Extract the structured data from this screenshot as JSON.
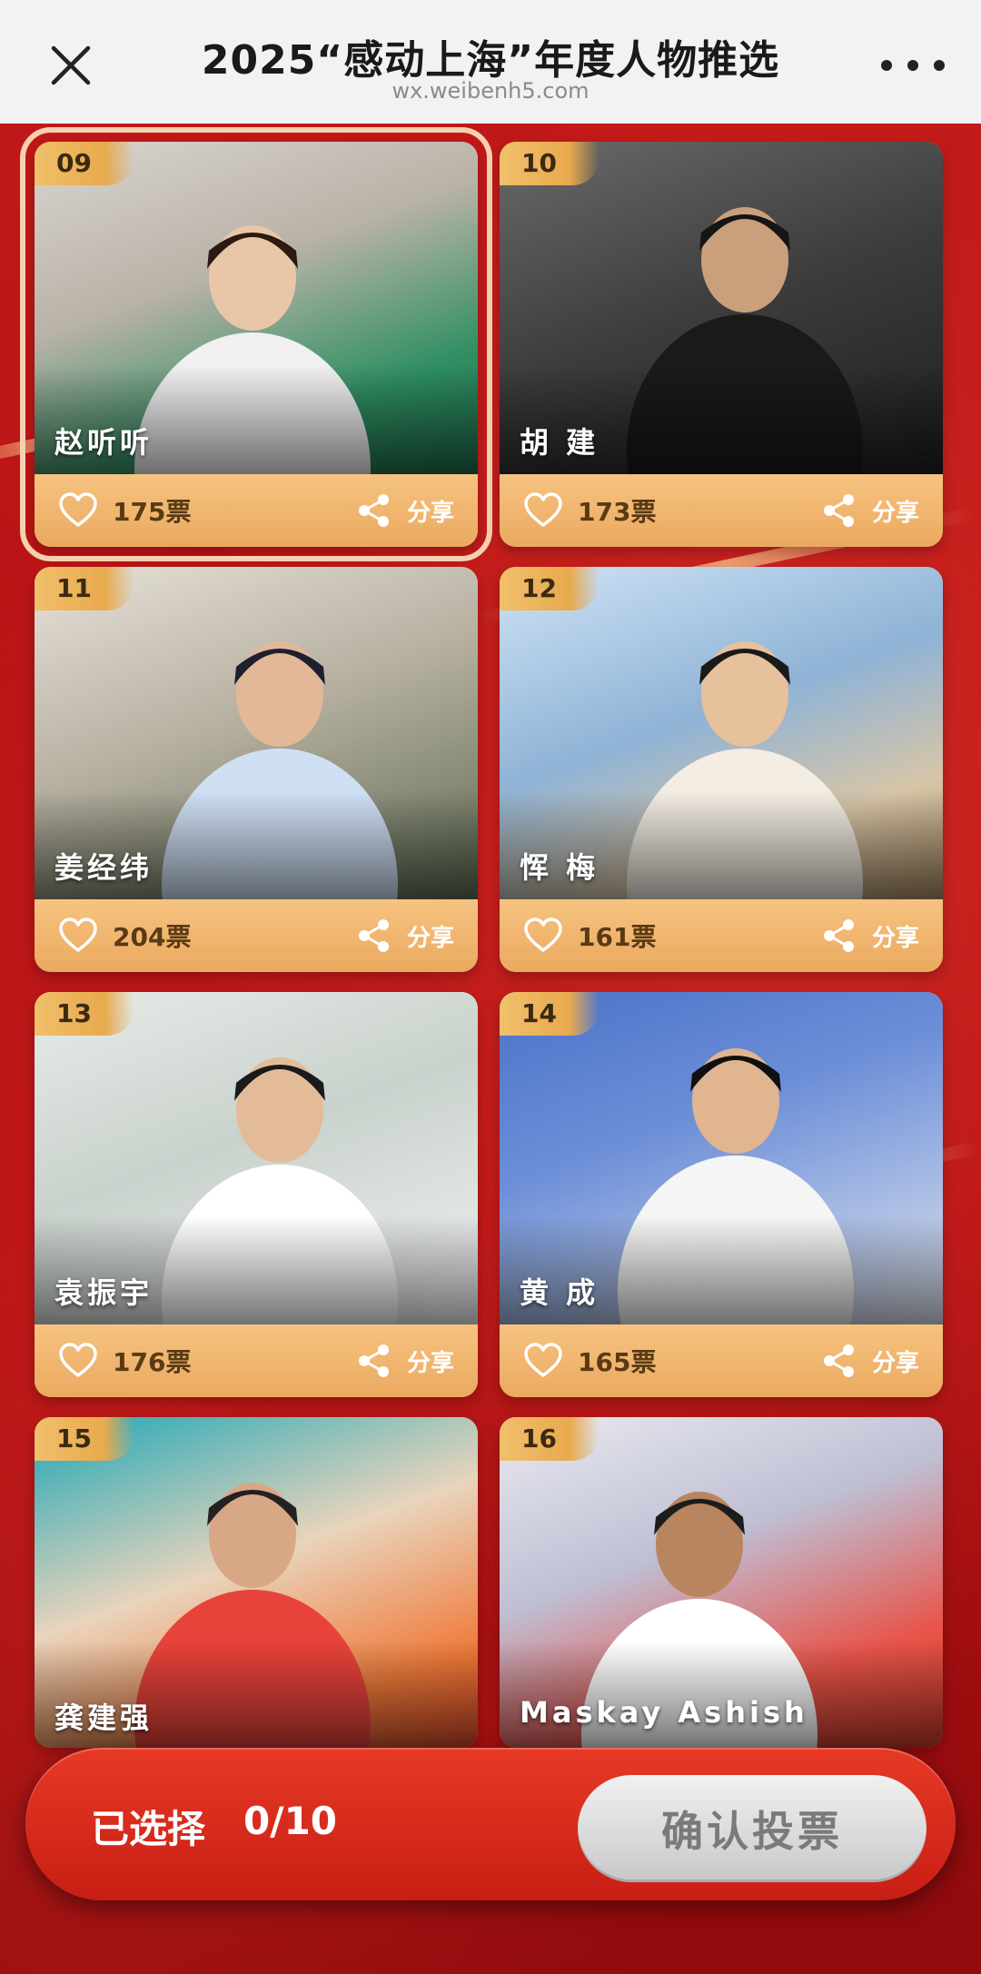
{
  "header": {
    "title": "2025“感动上海”年度人物推选",
    "domain": "wx.weibenh5.com",
    "close_icon": "close-icon",
    "more_icon": "more-icon"
  },
  "candidates": [
    {
      "number": "09",
      "name": "赵听听",
      "votes": "175票",
      "share": "分享",
      "selected": true
    },
    {
      "number": "10",
      "name": "胡 建",
      "votes": "173票",
      "share": "分享",
      "selected": false
    },
    {
      "number": "11",
      "name": "姜经纬",
      "votes": "204票",
      "share": "分享",
      "selected": false
    },
    {
      "number": "12",
      "name": "恽 梅",
      "votes": "161票",
      "share": "分享",
      "selected": false
    },
    {
      "number": "13",
      "name": "袁振宇",
      "votes": "176票",
      "share": "分享",
      "selected": false
    },
    {
      "number": "14",
      "name": "黄 成",
      "votes": "165票",
      "share": "分享",
      "selected": false
    },
    {
      "number": "15",
      "name": "龚建强",
      "votes": "",
      "share": "",
      "selected": false
    },
    {
      "number": "16",
      "name": "Maskay Ashish",
      "votes": "",
      "share": "",
      "selected": false
    }
  ],
  "selection": {
    "label": "已选择",
    "count": "0/10",
    "confirm_label": "确认投票"
  },
  "colors": {
    "accent_red": "#c01818",
    "card_gold": "#eba95f",
    "badge_gold": "#f0c06b"
  }
}
